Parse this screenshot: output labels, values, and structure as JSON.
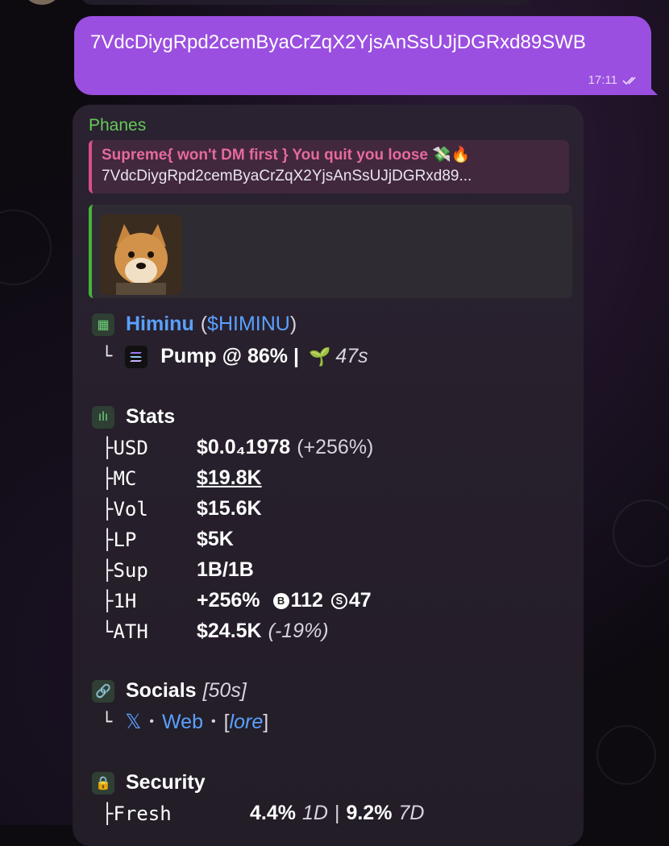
{
  "outgoing": {
    "text": "7VdcDiygRpd2cemByaCrZqX2YjsAnSsUJjDGRxd89SWB",
    "time": "17:11"
  },
  "incoming": {
    "sender": "Phanes",
    "reply": {
      "title": "Supreme{ won't DM first } You quit you loose 💸🔥",
      "text": "7VdcDiygRpd2cemByaCrZqX2YjsAnSsUJjDGRxd89..."
    },
    "token": {
      "name": "Himinu",
      "ticker_open": "(",
      "ticker": "$HIMINU",
      "ticker_close": ")",
      "platform": "Pump @ 86% |",
      "age": "47s"
    },
    "stats": {
      "heading": "Stats",
      "rows": [
        {
          "label": "USD",
          "value": "$0.0₄1978",
          "extra": "(+256%)"
        },
        {
          "label": "MC",
          "value": "$19.8K",
          "extra": ""
        },
        {
          "label": "Vol",
          "value": "$15.6K",
          "extra": ""
        },
        {
          "label": "LP",
          "value": "$5K",
          "extra": ""
        },
        {
          "label": "Sup",
          "value": "1B/1B",
          "extra": ""
        },
        {
          "label": "1H",
          "value": "+256%",
          "buys": "112",
          "sells": "47"
        },
        {
          "label": "ATH",
          "value": "$24.5K",
          "extra": "(-19%)"
        }
      ]
    },
    "socials": {
      "heading": "Socials",
      "age": "[50s]",
      "x": "𝕏",
      "dot": "•",
      "web": "Web",
      "lore_open": "[",
      "lore": "lore",
      "lore_close": "]"
    },
    "security": {
      "heading": "Security",
      "fresh_label": "Fresh",
      "fresh_1d": "4.4%",
      "fresh_1d_unit": "1D",
      "sep": "|",
      "fresh_7d": "9.2%",
      "fresh_7d_unit": "7D"
    }
  },
  "colors": {
    "outgoing_bubble": "#9b4fe0",
    "sender": "#66c95a",
    "reply_accent": "#d94f8a",
    "link": "#5aa0ff",
    "preview_accent": "#46b33a"
  }
}
